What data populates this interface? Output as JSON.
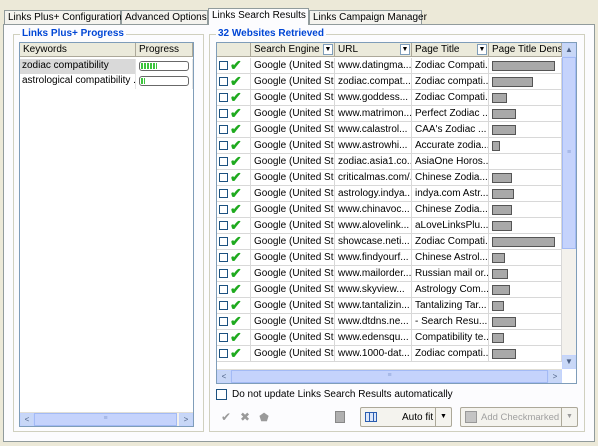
{
  "tabs": [
    {
      "label": "Links Plus+ Configuration",
      "active": false
    },
    {
      "label": "Advanced Options",
      "active": false
    },
    {
      "label": "Links Search Results",
      "active": true
    },
    {
      "label": "Links Campaign Manager",
      "active": false
    }
  ],
  "progress_panel": {
    "title": "Links Plus+ Progress",
    "columns": [
      "Keywords",
      "Progress"
    ],
    "rows": [
      {
        "keyword": "zodiac compatibility",
        "progress": 0.35,
        "selected": true
      },
      {
        "keyword": "astrological compatibility ...",
        "progress": 0.08,
        "selected": false
      }
    ],
    "scroll_left": "<",
    "scroll_right": ">"
  },
  "results_panel": {
    "title": "32 Websites Retrieved",
    "columns": [
      "Search Engine",
      "URL",
      "Page Title",
      "Page Title Density"
    ],
    "rows": [
      {
        "engine": "Google (United St...",
        "url": "www.datingma...",
        "title": "Zodiac Compati...",
        "density": 0.95
      },
      {
        "engine": "Google (United St...",
        "url": "zodiac.compat...",
        "title": "Zodiac compati...",
        "density": 0.62
      },
      {
        "engine": "Google (United St...",
        "url": "www.goddess...",
        "title": "Zodiac Compati...",
        "density": 0.22
      },
      {
        "engine": "Google (United St...",
        "url": "www.matrimon...",
        "title": "Perfect Zodiac ...",
        "density": 0.36
      },
      {
        "engine": "Google (United St...",
        "url": "www.calastrol...",
        "title": "CAA's Zodiac ...",
        "density": 0.36
      },
      {
        "engine": "Google (United St...",
        "url": "www.astrowhi...",
        "title": "Accurate zodia...",
        "density": 0.12
      },
      {
        "engine": "Google (United St...",
        "url": "zodiac.asia1.co...",
        "title": "AsiaOne Horos...",
        "density": 0.0
      },
      {
        "engine": "Google (United St...",
        "url": "criticalmas.com/...",
        "title": "Chinese Zodia...",
        "density": 0.3
      },
      {
        "engine": "Google (United St...",
        "url": "astrology.indya...",
        "title": "indya.com Astr...",
        "density": 0.33
      },
      {
        "engine": "Google (United St...",
        "url": "www.chinavoc...",
        "title": "Chinese Zodia...",
        "density": 0.3
      },
      {
        "engine": "Google (United St...",
        "url": "www.alovelink...",
        "title": "aLoveLinksPlu...",
        "density": 0.3
      },
      {
        "engine": "Google (United St...",
        "url": "showcase.neti...",
        "title": "Zodiac Compati...",
        "density": 0.95
      },
      {
        "engine": "Google (United St...",
        "url": "www.findyourf...",
        "title": "Chinese Astrol...",
        "density": 0.2
      },
      {
        "engine": "Google (United St...",
        "url": "www.mailorder...",
        "title": "Russian mail or...",
        "density": 0.24
      },
      {
        "engine": "Google (United St...",
        "url": "www.skyview...",
        "title": "Astrology Com...",
        "density": 0.28
      },
      {
        "engine": "Google (United St...",
        "url": "www.tantalizin...",
        "title": "Tantalizing Tar...",
        "density": 0.18
      },
      {
        "engine": "Google (United St...",
        "url": "www.dtdns.ne...",
        "title": " - Search Resu...",
        "density": 0.36
      },
      {
        "engine": "Google (United St...",
        "url": "www.edensqu...",
        "title": "Compatibility te...",
        "density": 0.18
      },
      {
        "engine": "Google (United St...",
        "url": "www.1000-dat...",
        "title": "Zodiac compati...",
        "density": 0.36
      }
    ]
  },
  "options": {
    "no_update_label": "Do not update Links Search Results automatically",
    "no_update_checked": false
  },
  "toolbar": {
    "autofit_label": "Auto fit",
    "add_checkmarked_label": "Add Checkmarked"
  }
}
